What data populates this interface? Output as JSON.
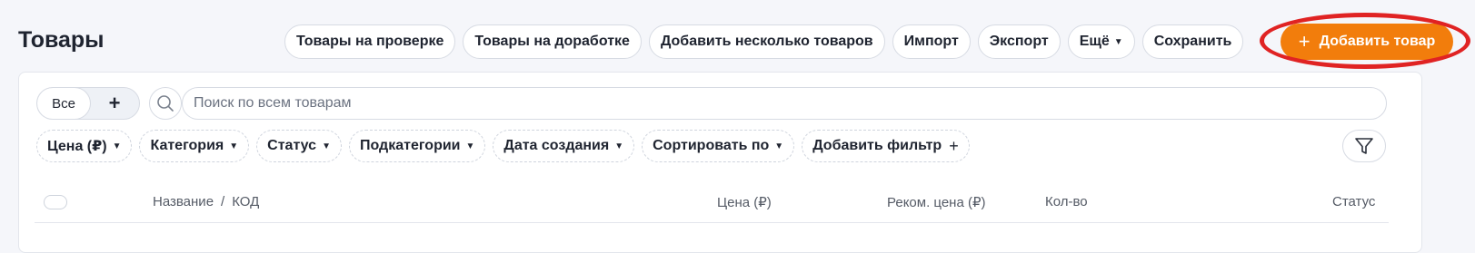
{
  "header": {
    "title": "Товары"
  },
  "toolbar": {
    "buttons": [
      {
        "label": "Товары на проверке"
      },
      {
        "label": "Товары на доработке"
      },
      {
        "label": "Добавить несколько товаров"
      },
      {
        "label": "Импорт"
      },
      {
        "label": "Экспорт"
      },
      {
        "label": "Ещё",
        "has_dropdown": true
      },
      {
        "label": "Сохранить"
      }
    ],
    "primary": {
      "label": "Добавить товар",
      "icon": "plus-icon"
    }
  },
  "segment": {
    "all_label": "Все",
    "add_label": "+"
  },
  "search": {
    "placeholder": "Поиск по всем товарам",
    "value": ""
  },
  "filters": [
    {
      "label": "Цена (₽)",
      "icon": "chevron-down-icon"
    },
    {
      "label": "Категория",
      "icon": "chevron-down-icon"
    },
    {
      "label": "Статус",
      "icon": "chevron-down-icon"
    },
    {
      "label": "Подкатегории",
      "icon": "chevron-down-icon"
    },
    {
      "label": "Дата создания",
      "icon": "chevron-down-icon"
    },
    {
      "label": "Сортировать по",
      "icon": "chevron-down-icon"
    },
    {
      "label": "Добавить фильтр",
      "icon": "plus-icon"
    }
  ],
  "table": {
    "columns": {
      "name": "Название",
      "code": "КОД",
      "price": "Цена (₽)",
      "rec_price": "Реком. цена (₽)",
      "qty": "Кол-во",
      "status": "Статус"
    }
  },
  "colors": {
    "accent": "#f27d0c",
    "highlight": "#e02323",
    "background": "#f5f6fa"
  }
}
